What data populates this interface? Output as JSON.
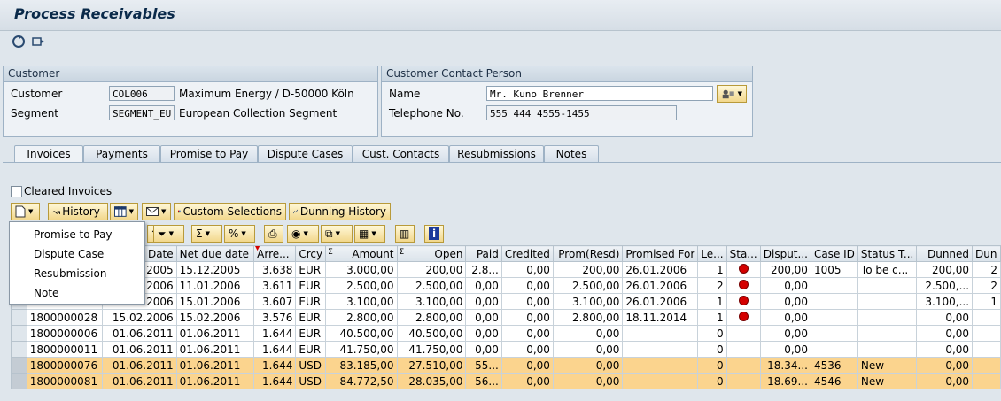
{
  "title": "Process Receivables",
  "customer_box": {
    "heading": "Customer",
    "customer_label": "Customer",
    "customer_value": "COL006",
    "customer_desc": "Maximum Energy / D-50000 Köln",
    "segment_label": "Segment",
    "segment_value": "SEGMENT_EU",
    "segment_desc": "European Collection Segment"
  },
  "contact_box": {
    "heading": "Customer Contact Person",
    "name_label": "Name",
    "name_value": "Mr. Kuno Brenner",
    "phone_label": "Telephone No.",
    "phone_value": "555 444 4555-1455"
  },
  "tabs": [
    "Invoices",
    "Payments",
    "Promise to Pay",
    "Dispute Cases",
    "Cust. Contacts",
    "Resubmissions",
    "Notes"
  ],
  "cleared_invoices_label": "Cleared Invoices",
  "buttons": {
    "history": "History",
    "custom_selections": "Custom Selections",
    "dunning_history": "Dunning History"
  },
  "menu": [
    "Promise to Pay",
    "Dispute Case",
    "Resubmission",
    "Note"
  ],
  "columns": [
    "",
    "",
    "Date",
    "Net due date",
    "Arre...",
    "Crcy",
    "Amount",
    "Open",
    "Paid",
    "Credited",
    "Prom(Resd)",
    "Promised For",
    "Le...",
    "Sta...",
    "Disput...",
    "Case ID",
    "Status T...",
    "Dunned",
    "Dun"
  ],
  "rows": [
    [
      "",
      "",
      "2005",
      "15.12.2005",
      "3.638",
      "EUR",
      "3.000,00",
      "200,00",
      "2.8...",
      "0,00",
      "200,00",
      "26.01.2006",
      "1",
      "red",
      "200,00",
      "1005",
      "To be c...",
      "200,00",
      "2"
    ],
    [
      "",
      "",
      "2006",
      "11.01.2006",
      "3.611",
      "EUR",
      "2.500,00",
      "2.500,00",
      "0,00",
      "0,00",
      "2.500,00",
      "26.01.2006",
      "2",
      "red",
      "0,00",
      "",
      "",
      "2.500,...",
      "2"
    ],
    [
      "",
      "18000000...",
      "15.01.2006",
      "15.01.2006",
      "3.607",
      "EUR",
      "3.100,00",
      "3.100,00",
      "0,00",
      "0,00",
      "3.100,00",
      "26.01.2006",
      "1",
      "red",
      "0,00",
      "",
      "",
      "3.100,...",
      "1"
    ],
    [
      "",
      "1800000028",
      "15.02.2006",
      "15.02.2006",
      "3.576",
      "EUR",
      "2.800,00",
      "2.800,00",
      "0,00",
      "0,00",
      "2.800,00",
      "18.11.2014",
      "1",
      "red",
      "0,00",
      "",
      "",
      "0,00",
      ""
    ],
    [
      "",
      "1800000006",
      "01.06.2011",
      "01.06.2011",
      "1.644",
      "EUR",
      "40.500,00",
      "40.500,00",
      "0,00",
      "0,00",
      "0,00",
      "",
      "0",
      "",
      "0,00",
      "",
      "",
      "0,00",
      ""
    ],
    [
      "",
      "1800000011",
      "01.06.2011",
      "01.06.2011",
      "1.644",
      "EUR",
      "41.750,00",
      "41.750,00",
      "0,00",
      "0,00",
      "0,00",
      "",
      "0",
      "",
      "0,00",
      "",
      "",
      "0,00",
      ""
    ],
    [
      "",
      "1800000076",
      "01.06.2011",
      "01.06.2011",
      "1.644",
      "USD",
      "83.185,00",
      "27.510,00",
      "55...",
      "0,00",
      "0,00",
      "",
      "0",
      "",
      "18.34...",
      "4536",
      "New",
      "0,00",
      ""
    ],
    [
      "",
      "1800000081",
      "01.06.2011",
      "01.06.2011",
      "1.644",
      "USD",
      "84.772,50",
      "28.035,00",
      "56...",
      "0,00",
      "0,00",
      "",
      "0",
      "",
      "18.69...",
      "4546",
      "New",
      "0,00",
      ""
    ]
  ]
}
